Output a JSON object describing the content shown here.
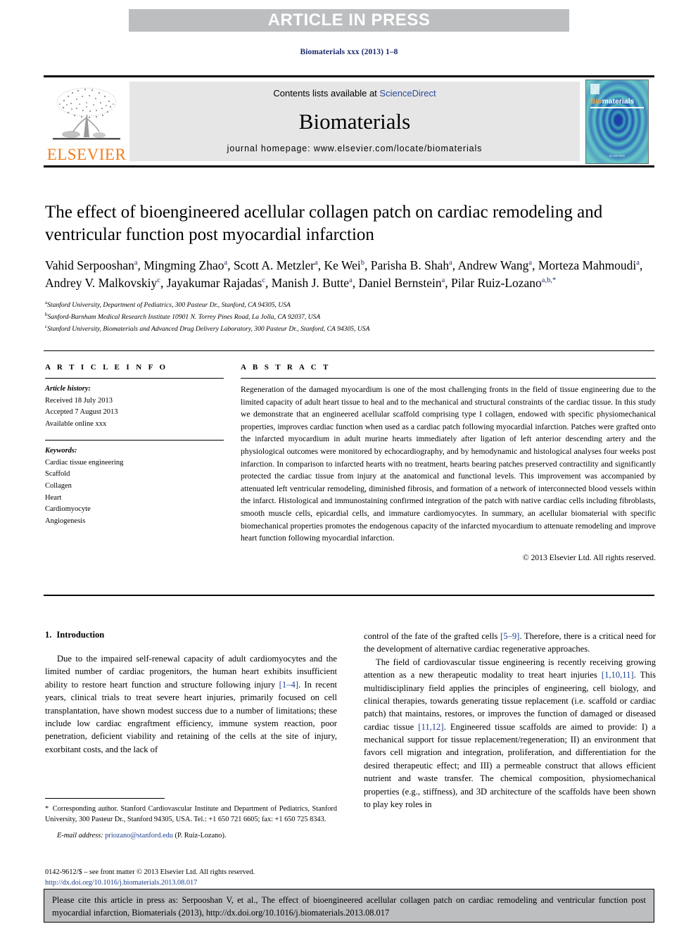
{
  "banner": {
    "text": "ARTICLE IN PRESS"
  },
  "running_head": "Biomaterials xxx (2013) 1–8",
  "journal_header": {
    "contents_prefix": "Contents lists available at ",
    "sciencedirect": "ScienceDirect",
    "journal_title": "Biomaterials",
    "homepage": "journal homepage: www.elsevier.com/locate/biomaterials",
    "publisher_logo_text": "ELSEVIER",
    "cover": {
      "title_part1": "Bio",
      "title_part2": "materials",
      "footer": "ELSEVIER"
    }
  },
  "article": {
    "title": "The effect of bioengineered acellular collagen patch on cardiac remodeling and ventricular function post myocardial infarction",
    "authors": [
      {
        "name": "Vahid Serpooshan",
        "sup": "a",
        "sep": ", "
      },
      {
        "name": "Mingming Zhao",
        "sup": "a",
        "sep": ", "
      },
      {
        "name": "Scott A. Metzler",
        "sup": "a",
        "sep": ", "
      },
      {
        "name": "Ke Wei",
        "sup": "b",
        "sep": ", "
      },
      {
        "name": "Parisha B. Shah",
        "sup": "a",
        "sep": ", "
      },
      {
        "name": "Andrew Wang",
        "sup": "a",
        "sep": ", "
      },
      {
        "name": "Morteza Mahmoudi",
        "sup": "a",
        "sep": ", "
      },
      {
        "name": "Andrey V. Malkovskiy",
        "sup": "c",
        "sep": ", "
      },
      {
        "name": "Jayakumar Rajadas",
        "sup": "c",
        "sep": ", "
      },
      {
        "name": "Manish J. Butte",
        "sup": "a",
        "sep": ", "
      },
      {
        "name": "Daniel Bernstein",
        "sup": "a",
        "sep": ", "
      },
      {
        "name": "Pilar Ruiz-Lozano",
        "sup": "a,b,*",
        "sep": ""
      }
    ],
    "affiliations": [
      {
        "marker": "a",
        "text": "Stanford University, Department of Pediatrics, 300 Pasteur Dr., Stanford, CA 94305, USA"
      },
      {
        "marker": "b",
        "text": "Sanford-Burnham Medical Research Institute 10901 N. Torrey Pines Road, La Jolla, CA 92037, USA"
      },
      {
        "marker": "c",
        "text": "Stanford University, Biomaterials and Advanced Drug Delivery Laboratory, 300 Pasteur Dr., Stanford, CA 94305, USA"
      }
    ]
  },
  "article_info": {
    "heading": "A R T I C L E  I N F O",
    "history_label": "Article history:",
    "history": [
      "Received 18 July 2013",
      "Accepted 7 August 2013",
      "Available online xxx"
    ],
    "keywords_label": "Keywords:",
    "keywords": [
      "Cardiac tissue engineering",
      "Scaffold",
      "Collagen",
      "Heart",
      "Cardiomyocyte",
      "Angiogenesis"
    ]
  },
  "abstract": {
    "heading": "A B S T R A C T",
    "text": "Regeneration of the damaged myocardium is one of the most challenging fronts in the field of tissue engineering due to the limited capacity of adult heart tissue to heal and to the mechanical and structural constraints of the cardiac tissue. In this study we demonstrate that an engineered acellular scaffold comprising type I collagen, endowed with specific physiomechanical properties, improves cardiac function when used as a cardiac patch following myocardial infarction. Patches were grafted onto the infarcted myocardium in adult murine hearts immediately after ligation of left anterior descending artery and the physiological outcomes were monitored by echocardiography, and by hemodynamic and histological analyses four weeks post infarction. In comparison to infarcted hearts with no treatment, hearts bearing patches preserved contractility and significantly protected the cardiac tissue from injury at the anatomical and functional levels. This improvement was accompanied by attenuated left ventricular remodeling, diminished fibrosis, and formation of a network of interconnected blood vessels within the infarct. Histological and immunostaining confirmed integration of the patch with native cardiac cells including fibroblasts, smooth muscle cells, epicardial cells, and immature cardiomyocytes. In summary, an acellular biomaterial with specific biomechanical properties promotes the endogenous capacity of the infarcted myocardium to attenuate remodeling and improve heart function following myocardial infarction.",
    "copyright": "© 2013 Elsevier Ltd. All rights reserved."
  },
  "introduction": {
    "number": "1.",
    "heading": "Introduction",
    "left_paragraphs": [
      {
        "pre": "Due to the impaired self-renewal capacity of adult cardiomyocytes and the limited number of cardiac progenitors, the human heart exhibits insufficient ability to restore heart function and structure following injury ",
        "ref": "[1–4]",
        "post": ". In recent years, clinical trials to treat severe heart injuries, primarily focused on cell transplantation, have shown modest success due to a number of limitations; these include low cardiac engraftment efficiency, immune system reaction, poor penetration, deficient viability and retaining of the cells at the site of injury, exorbitant costs, and the lack of"
      }
    ],
    "right_paragraphs": [
      {
        "pre": "control of the fate of the grafted cells ",
        "ref": "[5–9]",
        "post": ". Therefore, there is a critical need for the development of alternative cardiac regenerative approaches.",
        "indent": false
      },
      {
        "pre": "The field of cardiovascular tissue engineering is recently receiving growing attention as a new therapeutic modality to treat heart injuries ",
        "ref": "[1,10,11]",
        "mid": ". This multidisciplinary field applies the principles of engineering, cell biology, and clinical therapies, towards generating tissue replacement (i.e. scaffold or cardiac patch) that maintains, restores, or improves the function of damaged or diseased cardiac tissue ",
        "ref2": "[11,12]",
        "post": ". Engineered tissue scaffolds are aimed to provide: I) a mechanical support for tissue replacement/regeneration; II) an environment that favors cell migration and integration, proliferation, and differentiation for the desired therapeutic effect; and III) a permeable construct that allows efficient nutrient and waste transfer. The chemical composition, physiomechanical properties (e.g., stiffness), and 3D architecture of the scaffolds have been shown to play key roles in",
        "indent": true
      }
    ]
  },
  "footnote": {
    "star": "*",
    "corresponding": " Corresponding author. Stanford Cardiovascular Institute and Department of Pediatrics, Stanford University, 300 Pasteur Dr., Stanford 94305, USA. Tel.: +1 650 721 6605; fax: +1 650 725 8343.",
    "email_label": "E-mail address:",
    "email": "priozano@stanford.edu",
    "email_owner": " (P. Ruiz-Lozano)."
  },
  "issn": {
    "line": "0142-9612/$ – see front matter © 2013 Elsevier Ltd. All rights reserved.",
    "doi": "http://dx.doi.org/10.1016/j.biomaterials.2013.08.017"
  },
  "cite_box": {
    "text": "Please cite this article in press as: Serpooshan V, et al., The effect of bioengineered acellular collagen patch on cardiac remodeling and ventricular function post myocardial infarction, Biomaterials (2013), http://dx.doi.org/10.1016/j.biomaterials.2013.08.017"
  },
  "colors": {
    "banner_gray": "#bcbec0",
    "link_blue": "#1b3f8f",
    "running_head_blue": "#1b2a6b",
    "elsevier_orange": "#f07d1a",
    "header_gray": "#e6e6e6"
  }
}
